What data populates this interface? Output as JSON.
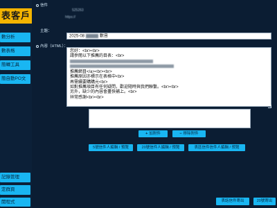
{
  "logo": "戶",
  "logo_prefix": "表客",
  "sidebar": {
    "top": [
      "數分析",
      "數表格",
      "簡轉工具",
      "簡自動PO文"
    ],
    "bottom": [
      "記錄管理",
      "定群頁",
      "開程式"
    ]
  },
  "header": {
    "line1_label": "信件",
    "line1_value": "525263",
    "line2_value": "https://"
  },
  "subject": {
    "label": "主題：",
    "value_prefix": "2025-08",
    "value_suffix": "數目"
  },
  "content": {
    "label": "內容（HTML）：",
    "lines": [
      "您好：<br><br>",
      "請參閱以下推薦的目表：<br>",
      "",
      "",
      "推薦網目</a><br><br>",
      "推薦原因亦標示在表格中<br>",
      "再需續要購購元<br>",
      "如對推薦項目有任何疑問，歡迎隨時與我們聯繫。<br><br>",
      "另外，缺少的內容會盡快補上。<br>",
      "祥常感謝<br><br>"
    ]
  },
  "attachments": {
    "add_label": "加附件",
    "remove_label": "移除附件"
  },
  "templates": {
    "btn1": "5號信件人編輯 / 預覽",
    "btn2": "20號信件人編輯 / 預覽",
    "btn3": "表區信件信件人編輯 / 預覽"
  },
  "footer": {
    "send_btn1": "表話信件寄出",
    "send_btn2": "20號寄出"
  },
  "colors": {
    "background": "#0b1d33",
    "accent": "#19b6f2",
    "logo_bg": "#f4b400"
  }
}
